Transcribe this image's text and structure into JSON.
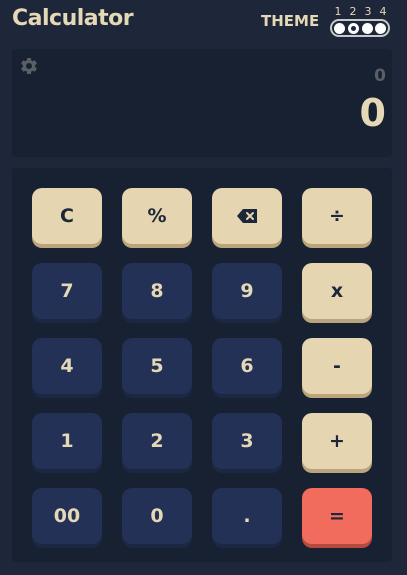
{
  "app": {
    "title": "Calculator"
  },
  "theme": {
    "label": "THEME",
    "options": [
      "1",
      "2",
      "3",
      "4"
    ],
    "selected": "2"
  },
  "display": {
    "expression": "0",
    "result": "0",
    "settings_icon": "gear-icon"
  },
  "keypad": {
    "rows": [
      [
        {
          "label": "C",
          "kind": "fn",
          "name": "clear-button"
        },
        {
          "label": "%",
          "kind": "fn",
          "name": "percent-button"
        },
        {
          "label": "",
          "kind": "fn",
          "name": "backspace-button",
          "icon": "backspace-icon"
        },
        {
          "label": "÷",
          "kind": "fn",
          "name": "divide-button"
        }
      ],
      [
        {
          "label": "7",
          "kind": "num",
          "name": "digit-7-button"
        },
        {
          "label": "8",
          "kind": "num",
          "name": "digit-8-button"
        },
        {
          "label": "9",
          "kind": "num",
          "name": "digit-9-button"
        },
        {
          "label": "x",
          "kind": "fn",
          "name": "multiply-button"
        }
      ],
      [
        {
          "label": "4",
          "kind": "num",
          "name": "digit-4-button"
        },
        {
          "label": "5",
          "kind": "num",
          "name": "digit-5-button"
        },
        {
          "label": "6",
          "kind": "num",
          "name": "digit-6-button"
        },
        {
          "label": "-",
          "kind": "fn",
          "name": "subtract-button"
        }
      ],
      [
        {
          "label": "1",
          "kind": "num",
          "name": "digit-1-button"
        },
        {
          "label": "2",
          "kind": "num",
          "name": "digit-2-button"
        },
        {
          "label": "3",
          "kind": "num",
          "name": "digit-3-button"
        },
        {
          "label": "+",
          "kind": "fn",
          "name": "add-button"
        }
      ],
      [
        {
          "label": "00",
          "kind": "num",
          "name": "digit-00-button"
        },
        {
          "label": "0",
          "kind": "num",
          "name": "digit-0-button"
        },
        {
          "label": ".",
          "kind": "num",
          "name": "decimal-button"
        },
        {
          "label": "=",
          "kind": "eq",
          "name": "equals-button"
        }
      ]
    ]
  },
  "colors": {
    "background": "#1d2739",
    "panel": "#172131",
    "number_key": "#243156",
    "function_key": "#e5d5b1",
    "equals_key": "#f26c5e",
    "text_light": "#e5d8b6"
  }
}
